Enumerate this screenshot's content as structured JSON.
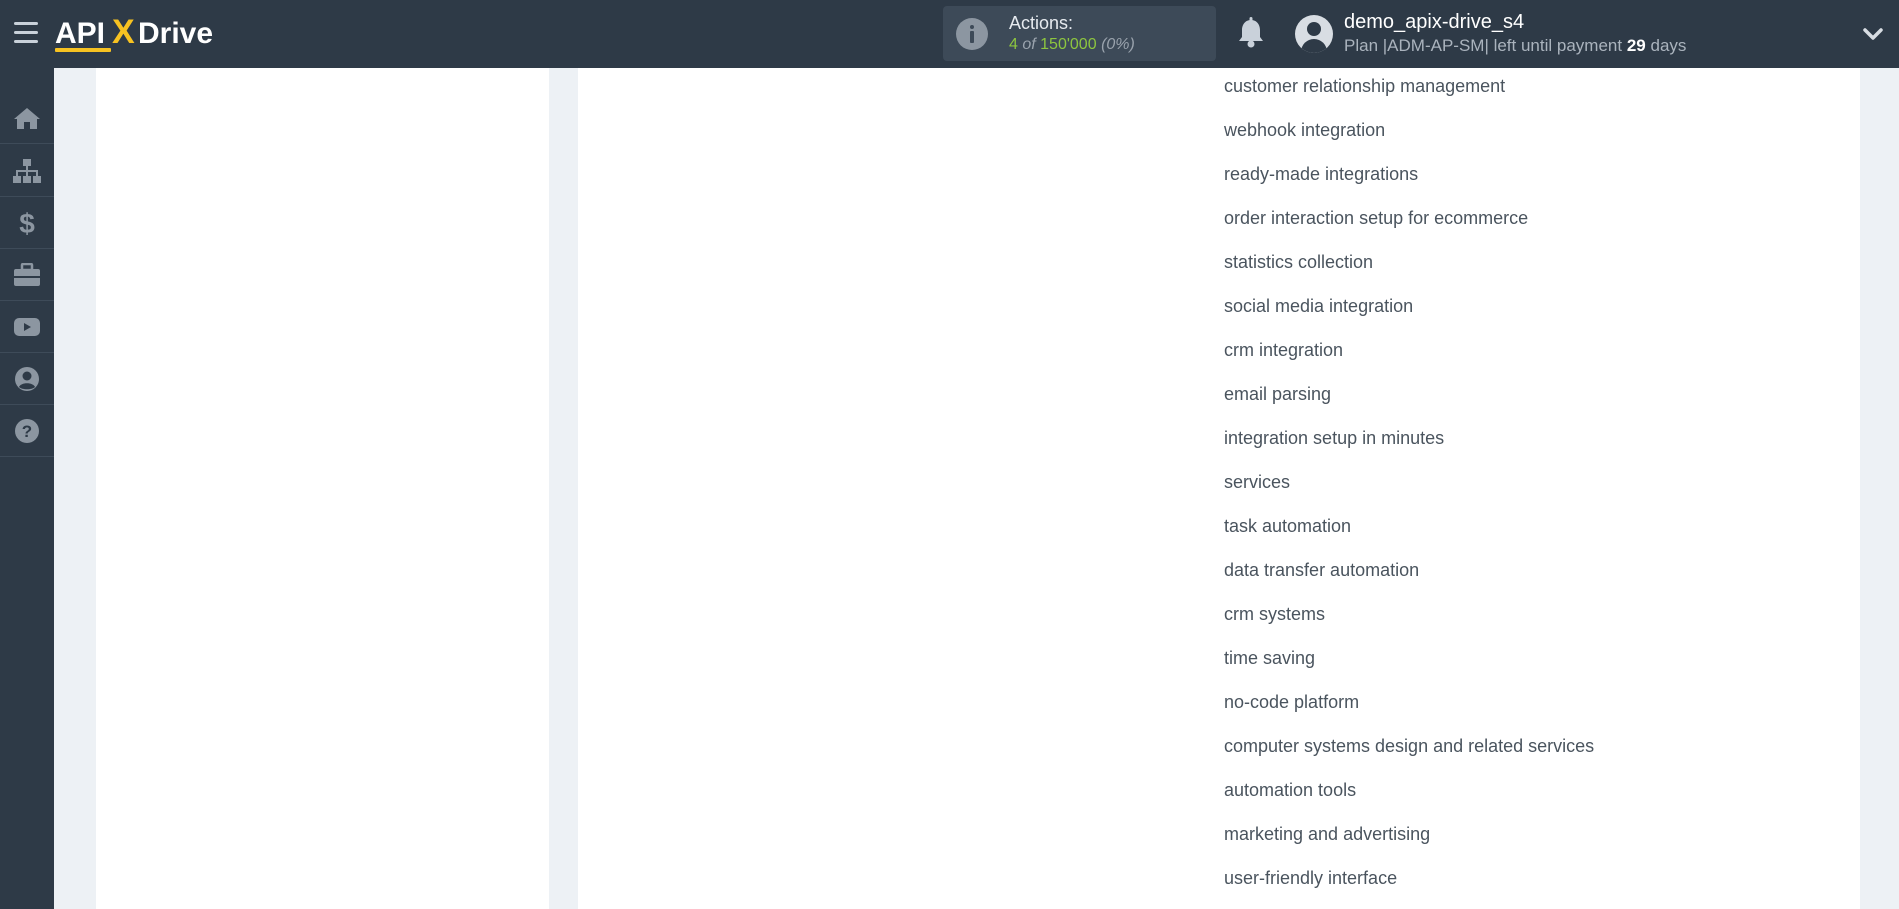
{
  "header": {
    "logo": {
      "part1": "API",
      "part2": "X",
      "part3": "Drive"
    },
    "actions": {
      "label": "Actions:",
      "used": "4",
      "of": "of",
      "total": "150'000",
      "percent": "(0%)"
    },
    "user": {
      "name": "demo_apix-drive_s4",
      "plan_prefix": "Plan |ADM-AP-SM| left until payment",
      "days_number": "29",
      "days_suffix": "days"
    },
    "icons": [
      "menu-icon",
      "info-icon",
      "bell-icon",
      "user-avatar-icon",
      "chevron-down-icon"
    ]
  },
  "sidebar": {
    "items": [
      {
        "name": "home",
        "icon": "home-icon"
      },
      {
        "name": "connections",
        "icon": "sitemap-icon"
      },
      {
        "name": "billing",
        "icon": "dollar-icon"
      },
      {
        "name": "services",
        "icon": "briefcase-icon"
      },
      {
        "name": "video",
        "icon": "youtube-icon"
      },
      {
        "name": "account",
        "icon": "user-circle-icon"
      },
      {
        "name": "help",
        "icon": "question-icon"
      }
    ]
  },
  "tags": [
    "customer relationship management",
    "webhook integration",
    "ready-made integrations",
    "order interaction setup for ecommerce",
    "statistics collection",
    "social media integration",
    "crm integration",
    "email parsing",
    "integration setup in minutes",
    "services",
    "task automation",
    "data transfer automation",
    "crm systems",
    "time saving",
    "no-code platform",
    "computer systems design and related services",
    "automation tools",
    "marketing and advertising",
    "user-friendly interface"
  ],
  "colors": {
    "topbar": "#2e3a47",
    "accent_green": "#8dc63f",
    "logo_x": "#f7c221",
    "page_bg": "#edf1f5"
  }
}
